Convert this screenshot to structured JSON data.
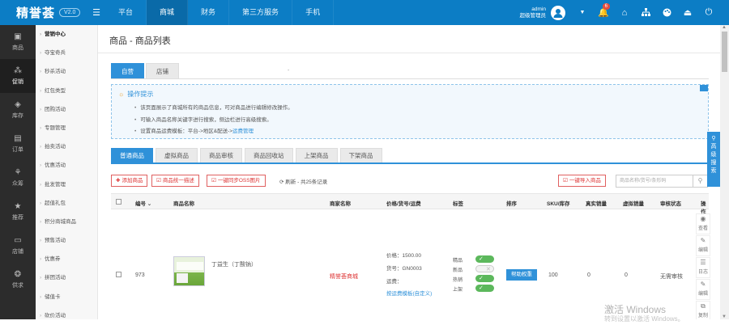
{
  "topbar": {
    "brand": "精誉荟",
    "version": "V2.0",
    "nav": [
      "平台",
      "商城",
      "财务",
      "第三方服务",
      "手机"
    ],
    "active_nav": "商城",
    "user_name": "admin",
    "user_role": "超级管理员",
    "notif_count": "6"
  },
  "leftbar": [
    {
      "label": "商品",
      "icon": "goods-icon"
    },
    {
      "label": "促销",
      "icon": "promotion-icon"
    },
    {
      "label": "库存",
      "icon": "stock-icon"
    },
    {
      "label": "订单",
      "icon": "order-icon"
    },
    {
      "label": "众筹",
      "icon": "crowdfunding-icon"
    },
    {
      "label": "推荐",
      "icon": "star-icon"
    },
    {
      "label": "店铺",
      "icon": "shop-icon"
    },
    {
      "label": "供求",
      "icon": "supply-icon"
    }
  ],
  "submenu": [
    "营销中心",
    "夺宝奇兵",
    "秒杀活动",
    "红包类型",
    "团购活动",
    "专题管理",
    "拍卖活动",
    "优惠活动",
    "批发管理",
    "超值礼包",
    "积分商城商品",
    "预售活动",
    "优惠券",
    "拼团活动",
    "储值卡",
    "砍价活动"
  ],
  "page": {
    "title": "商品 - 商品列表"
  },
  "seg_tabs": [
    "自营",
    "店铺"
  ],
  "tips": {
    "header": "操作提示",
    "items": [
      "该页面展示了商城所有的商品信息，可对商品进行编辑修改操作。",
      "可输入商品名称关键字进行搜索，侧边栏进行高级搜索。",
      "设置商品运费模板：平台->地区&配送->"
    ],
    "link": "运费管理"
  },
  "list_tabs": [
    "普通商品",
    "虚拟商品",
    "商品审核",
    "商品回收站",
    "上架商品",
    "下架商品"
  ],
  "toolbar": {
    "add": "添加商品",
    "edit": "商品统一描述",
    "oss": "一键同步OSS图片",
    "refresh": "刷新 - 共25条记录",
    "import": "一键导入商品",
    "search_placeholder": "商品名称/货号/条形码"
  },
  "table": {
    "headers": [
      "编号",
      "商品名称",
      "商家名称",
      "价格/货号/运费",
      "标签",
      "排序",
      "SKU/库存",
      "真实销量",
      "虚拟销量",
      "审核状态",
      "操作"
    ],
    "row": {
      "id": "973",
      "name": "丁益生（丁酸钠）",
      "shop": "精誉荟商城",
      "price": "价格：1500.00",
      "sku_no": "货号：GN0003",
      "freight": "运费：",
      "freight_link": "按运费模板(自定义)",
      "tags": [
        "精品",
        "新品",
        "热销",
        "上架"
      ],
      "sort_button": "帮助权重",
      "stock": "100",
      "real_sales": "0",
      "virtual_sales": "0",
      "status": "无需审核",
      "ops": [
        "查看",
        "编辑",
        "日志",
        "编辑",
        "复制"
      ]
    }
  },
  "side": {
    "adv_search": "高级搜索"
  },
  "watermark": {
    "line1": "激活 Windows",
    "line2": "转到设置以激活 Windows。"
  }
}
